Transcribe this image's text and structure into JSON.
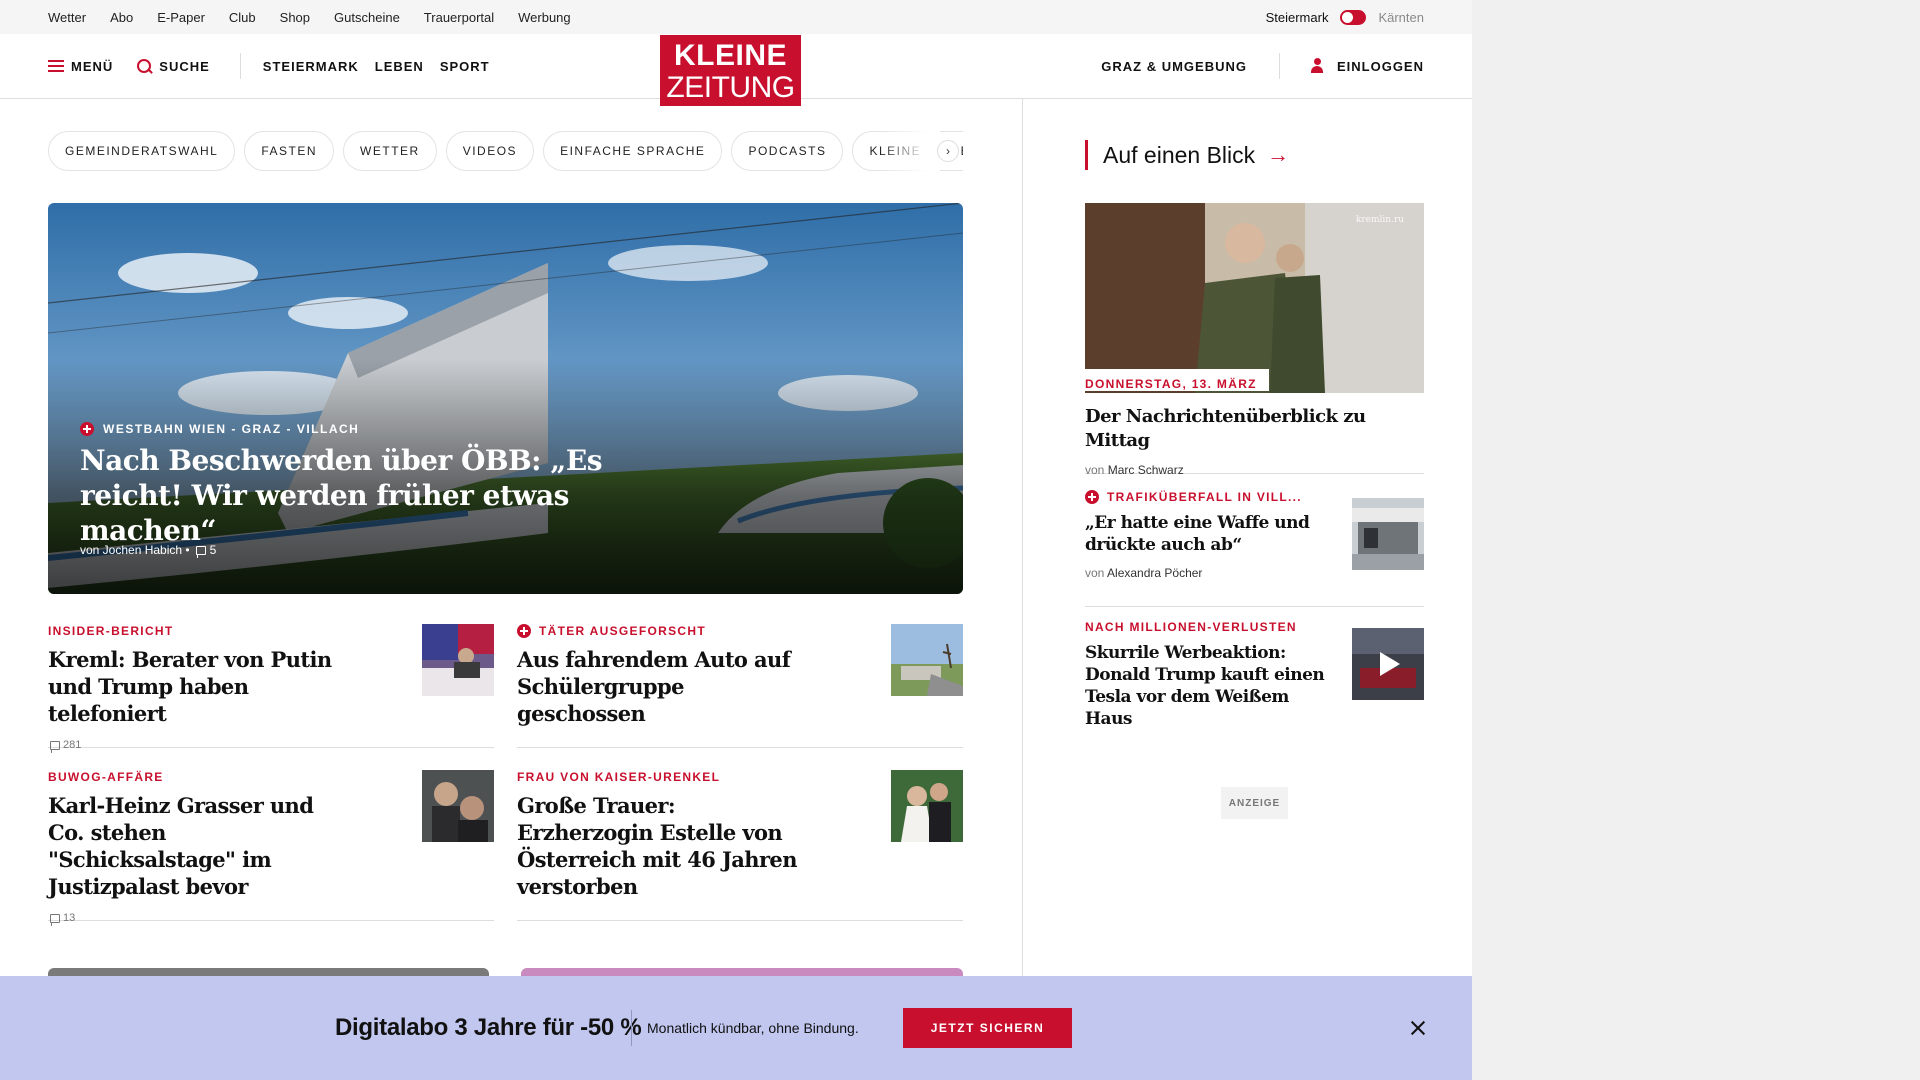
{
  "topbar": {
    "links": [
      "Wetter",
      "Abo",
      "E-Paper",
      "Club",
      "Shop",
      "Gutscheine",
      "Trauerportal",
      "Werbung"
    ],
    "region_active": "Steiermark",
    "region_inactive": "Kärnten"
  },
  "nav": {
    "menu_label": "MENÜ",
    "search_label": "SUCHE",
    "sections": [
      "STEIERMARK",
      "LEBEN",
      "SPORT"
    ],
    "logo_line1": "KLEINE",
    "logo_line2": "ZEITUNG",
    "local_label": "GRAZ & UMGEBUNG",
    "login_label": "EINLOGGEN"
  },
  "pills": [
    "GEMEINDERATSWAHL",
    "FASTEN",
    "WETTER",
    "VIDEOS",
    "EINFACHE SPRACHE",
    "PODCASTS",
    "KLEINE KINDER"
  ],
  "pills_next_icon": "chevron-right-icon",
  "hero": {
    "kicker": "WESTBAHN WIEN - GRAZ - VILLACH",
    "title": "Nach Beschwerden über ÖBB: „Es reicht! Wir werden früher etwas machen“",
    "author": "von Jochen Habich •",
    "comments": "5"
  },
  "articles": [
    {
      "kicker": "INSIDER-BERICHT",
      "premium": false,
      "title": "Kreml: Berater von Putin und Trump haben telefoniert",
      "comments": "281"
    },
    {
      "kicker": "TÄTER AUSGEFORSCHT",
      "premium": true,
      "title": "Aus fahrendem Auto auf Schülergruppe geschossen",
      "comments": ""
    },
    {
      "kicker": "BUWOG-AFFÄRE",
      "premium": false,
      "title": "Karl-Heinz Grasser und Co. stehen \"Schicksalstage\" im Justizpalast bevor",
      "comments": "13"
    },
    {
      "kicker": "FRAU VON KAISER-URENKEL",
      "premium": false,
      "title": "Große Trauer: Erzherzogin Estelle von Österreich mit 46 Jahren verstorben",
      "comments": ""
    }
  ],
  "sidebar": {
    "heading": "Auf einen Blick",
    "feature": {
      "date": "DONNERSTAG, 13. MÄRZ",
      "title": "Der Nachrichtenüberblick zu Mittag",
      "von": "von",
      "author": "Marc Schwarz",
      "watermark": "kremlin.ru"
    },
    "items": [
      {
        "kicker": "TRAFIKÜBERFALL IN VILL...",
        "premium": true,
        "title": "„Er hatte eine Waffe und drückte auch ab“",
        "von": "von",
        "author": "Alexandra Pöcher"
      },
      {
        "kicker": "NACH MILLIONEN-VERLUSTEN",
        "premium": false,
        "title": "Skurrile Werbeaktion: Donald Trump kauft einen Tesla vor dem Weißem Haus",
        "von": "",
        "author": ""
      }
    ],
    "ad_label": "ANZEIGE"
  },
  "promo": {
    "title": "Digitalabo 3 Jahre für -50 %",
    "subtitle": "Monatlich kündbar, ohne Bindung.",
    "button": "JETZT SICHERN"
  },
  "colors": {
    "brand_red": "#c8102e",
    "promo_bg": "#c1c7ef",
    "topbar_bg": "#f5f5f5"
  }
}
